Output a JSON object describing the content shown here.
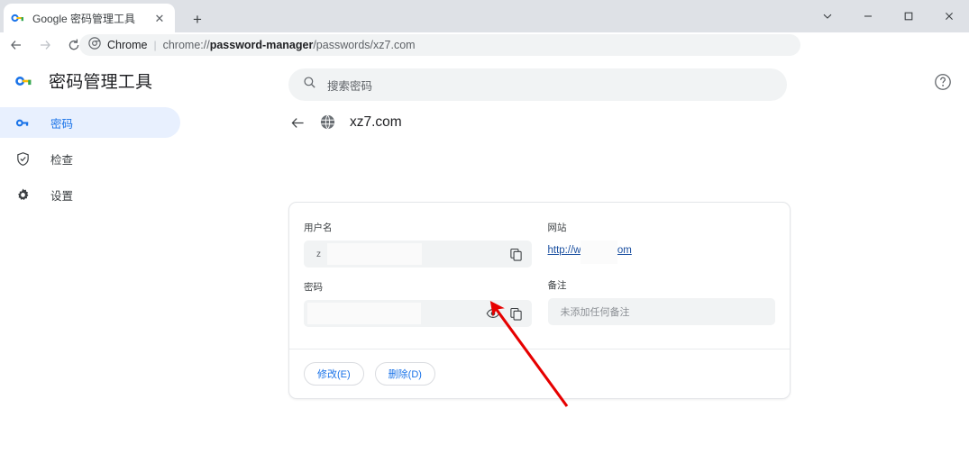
{
  "window": {
    "controls": [
      {
        "name": "chevron-down",
        "glyph": "⌄"
      },
      {
        "name": "minimize",
        "glyph": "−"
      },
      {
        "name": "maximize",
        "glyph": "□"
      },
      {
        "name": "close",
        "glyph": "✕"
      }
    ]
  },
  "tab": {
    "title": "Google 密码管理工具",
    "close_glyph": "✕",
    "newtab_glyph": "+"
  },
  "toolbar": {
    "back_glyph": "←",
    "forward_glyph": "→",
    "reload_glyph": "⟳",
    "chrome_label": "Chrome",
    "separator": "|",
    "url_prefix": "chrome://",
    "url_bold": "password-manager",
    "url_suffix": "/passwords/xz7.com",
    "url_full": "chrome://password-manager/passwords/xz7.com",
    "icons": [
      "install-icon",
      "share-icon",
      "bookmark-star-icon",
      "side-panel-icon",
      "profile-avatar",
      "more-menu-icon"
    ]
  },
  "app": {
    "brand_title": "密码管理工具",
    "brand_icon": "key-icon",
    "help_icon": "help-circle-icon"
  },
  "search": {
    "placeholder": "搜索密码",
    "icon": "search-icon"
  },
  "sidebar": {
    "items": [
      {
        "label": "密码",
        "icon": "key-icon",
        "active": true
      },
      {
        "label": "检查",
        "icon": "shield-check-icon",
        "active": false
      },
      {
        "label": "设置",
        "icon": "gear-icon",
        "active": false
      }
    ]
  },
  "detail": {
    "back_glyph": "←",
    "site_icon": "globe-icon",
    "site_name": "xz7.com",
    "fields": {
      "username": {
        "label": "用户名",
        "value": "z",
        "copy_icon": "copy-icon"
      },
      "password": {
        "label": "密码",
        "value": "",
        "show_icon": "eye-icon",
        "copy_icon": "copy-icon"
      },
      "website": {
        "label": "网站",
        "link_prefix": "http://w",
        "link_suffix": "com"
      },
      "note": {
        "label": "备注",
        "placeholder": "未添加任何备注"
      }
    },
    "actions": [
      {
        "label": "修改(E)",
        "name": "edit-button"
      },
      {
        "label": "删除(D)",
        "name": "delete-button"
      }
    ]
  },
  "annotation": {
    "color": "#e60000"
  }
}
